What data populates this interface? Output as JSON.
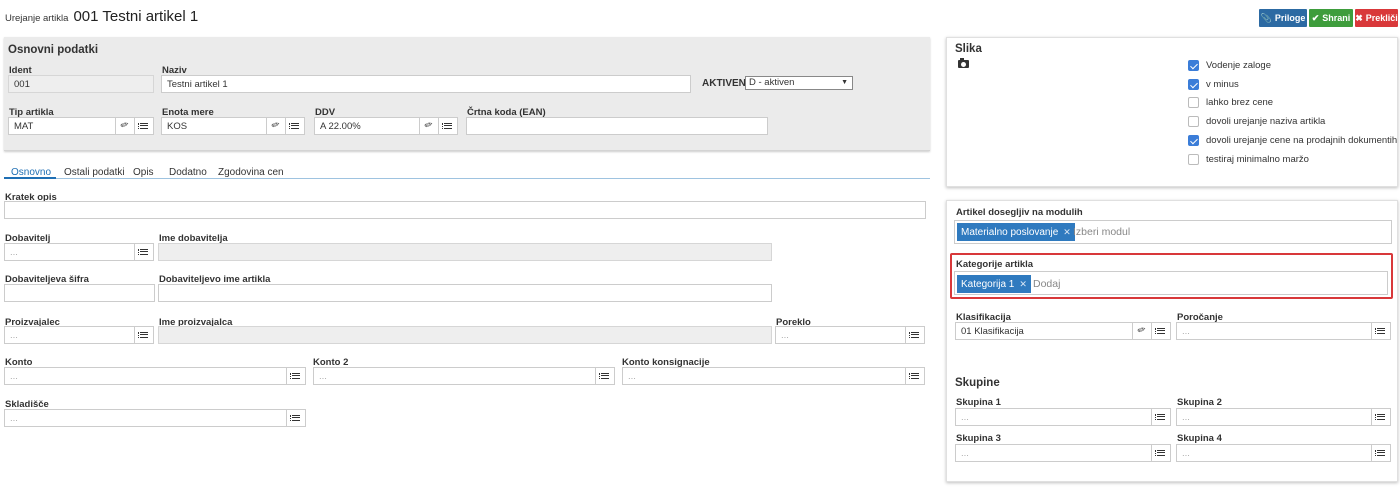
{
  "header": {
    "prefix": "Urejanje artikla",
    "title": "001 Testni artikel 1"
  },
  "buttons": {
    "attachments": "Priloge",
    "save": "Shrani",
    "cancel": "Prekliči"
  },
  "colors": {
    "attachments": "#2c6aa3",
    "save": "#3e9d3c",
    "cancel": "#d9383a",
    "tag": "#2f7abf",
    "highlight": "#d8383a"
  },
  "basic": {
    "title": "Osnovni podatki",
    "ident_label": "Ident",
    "ident_value": "001",
    "name_label": "Naziv",
    "name_value": "Testni artikel 1",
    "active_label": "AKTIVEN",
    "active_value": "D - aktiven",
    "type_label": "Tip artikla",
    "type_value": "MAT",
    "unit_label": "Enota mere",
    "unit_value": "KOS",
    "vat_label": "DDV",
    "vat_value": "A 22.00%",
    "ean_label": "Črtna koda (EAN)",
    "ean_value": ""
  },
  "tabs": [
    "Osnovno",
    "Ostali podatki",
    "Opis",
    "Dodatno",
    "Zgodovina cen"
  ],
  "form": {
    "short_desc_label": "Kratek opis",
    "supplier_label": "Dobavitelj",
    "supplier_placeholder": "...",
    "supplier_name_label": "Ime dobavitelja",
    "supplier_code_label": "Dobaviteljeva šifra",
    "supplier_item_label": "Dobaviteljevo ime artikla",
    "producer_label": "Proizvajalec",
    "producer_placeholder": "...",
    "producer_name_label": "Ime proizvajalca",
    "origin_label": "Poreklo",
    "origin_placeholder": "...",
    "account_label": "Konto",
    "account_placeholder": "...",
    "account2_label": "Konto 2",
    "account2_placeholder": "...",
    "consign_label": "Konto konsignacije",
    "consign_placeholder": "...",
    "warehouse_label": "Skladišče",
    "warehouse_placeholder": "..."
  },
  "image": {
    "title": "Slika",
    "camera_icon": "camera-icon"
  },
  "checks": [
    {
      "label": "Vodenje zaloge",
      "checked": true
    },
    {
      "label": "v minus",
      "checked": true
    },
    {
      "label": "lahko brez cene",
      "checked": false
    },
    {
      "label": "dovoli urejanje naziva artikla",
      "checked": false
    },
    {
      "label": "dovoli urejanje cene na prodajnih dokumentih",
      "checked": true
    },
    {
      "label": "testiraj minimalno maržo",
      "checked": false
    }
  ],
  "modules": {
    "label": "Artikel dosegljiv na modulih",
    "tag": "Materialno poslovanje",
    "placeholder": "Izberi modul"
  },
  "categories": {
    "label": "Kategorije artikla",
    "tag": "Kategorija 1",
    "placeholder": "Dodaj"
  },
  "classification": {
    "label": "Klasifikacija",
    "value": "01 Klasifikacija",
    "report_label": "Poročanje",
    "report_placeholder": "..."
  },
  "groups": {
    "title": "Skupine",
    "items": [
      {
        "label": "Skupina 1",
        "placeholder": "..."
      },
      {
        "label": "Skupina 2",
        "placeholder": "..."
      },
      {
        "label": "Skupina 3",
        "placeholder": "..."
      },
      {
        "label": "Skupina 4",
        "placeholder": "..."
      }
    ]
  }
}
